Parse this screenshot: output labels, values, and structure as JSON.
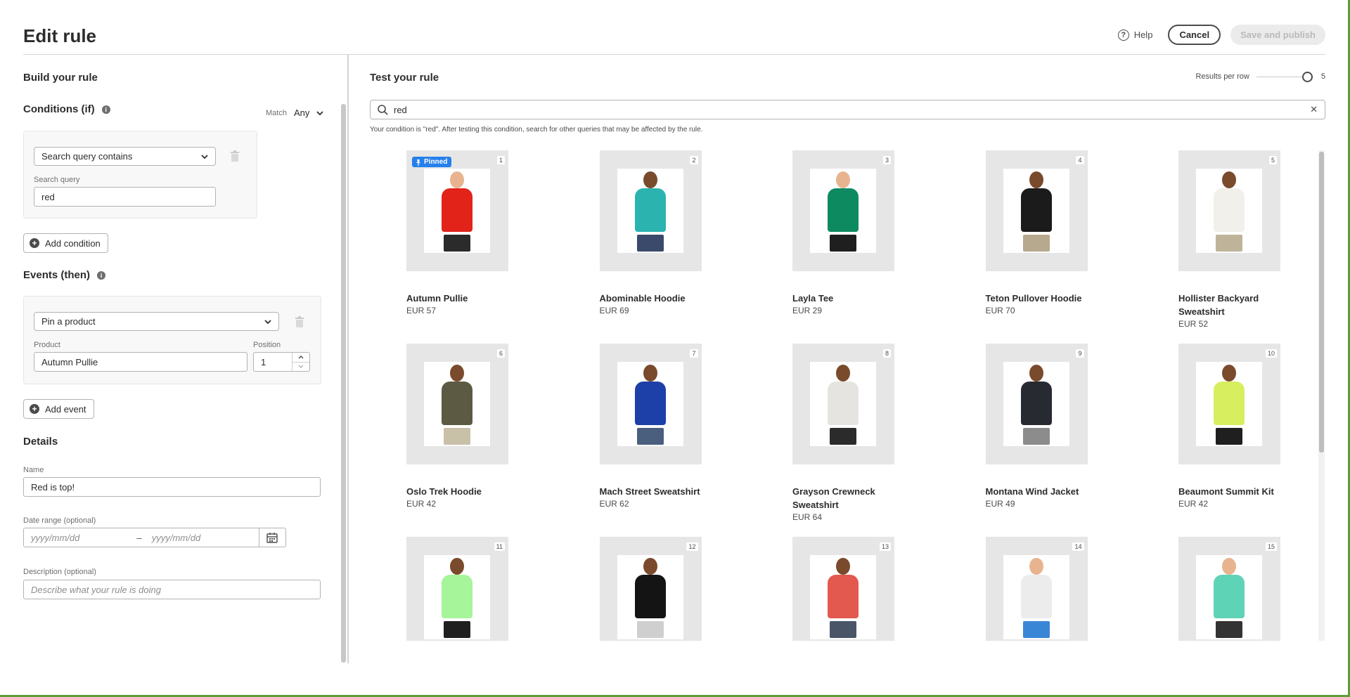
{
  "header": {
    "title": "Edit rule",
    "help_label": "Help",
    "cancel_label": "Cancel",
    "save_label": "Save and publish"
  },
  "build": {
    "heading": "Build your rule",
    "conditions_heading": "Conditions (if)",
    "match_label": "Match",
    "match_value": "Any",
    "condition_type": "Search query contains",
    "search_query_label": "Search query",
    "search_query_value": "red",
    "add_condition_label": "Add condition",
    "events_heading": "Events (then)",
    "event_type": "Pin a product",
    "product_label": "Product",
    "product_value": "Autumn Pullie",
    "position_label": "Position",
    "position_value": "1",
    "add_event_label": "Add event",
    "details_heading": "Details",
    "name_label": "Name",
    "name_value": "Red is top!",
    "date_range_label": "Date range (optional)",
    "date_start_placeholder": "yyyy/mm/dd",
    "date_separator": "–",
    "date_end_placeholder": "yyyy/mm/dd",
    "description_label": "Description (optional)",
    "description_placeholder": "Describe what your rule is doing"
  },
  "test": {
    "heading": "Test your rule",
    "results_per_row_label": "Results per row",
    "results_per_row_value": "5",
    "search_value": "red",
    "hint": "Your condition is \"red\". After testing this condition, search for other queries that may be affected by the rule.",
    "pinned_label": "Pinned"
  },
  "products": [
    {
      "index": "1",
      "name": "Autumn Pullie",
      "price": "EUR 57",
      "pinned": true,
      "skin": "#e8b48f",
      "top": "#e2231a",
      "bottom": "#2b2b2b"
    },
    {
      "index": "2",
      "name": "Abominable Hoodie",
      "price": "EUR 69",
      "skin": "#7a4a2c",
      "top": "#2bb3b0",
      "bottom": "#3b4a6b"
    },
    {
      "index": "3",
      "name": "Layla Tee",
      "price": "EUR 29",
      "skin": "#e8b48f",
      "top": "#0e8a61",
      "bottom": "#1f1f1f"
    },
    {
      "index": "4",
      "name": "Teton Pullover Hoodie",
      "price": "EUR 70",
      "skin": "#7a4a2c",
      "top": "#1b1b1b",
      "bottom": "#b7a98e"
    },
    {
      "index": "5",
      "name": "Hollister Backyard Sweatshirt",
      "price": "EUR 52",
      "skin": "#7a4a2c",
      "top": "#f2f0ea",
      "bottom": "#bfb49a"
    },
    {
      "index": "6",
      "name": "Oslo Trek Hoodie",
      "price": "EUR 42",
      "skin": "#7a4a2c",
      "top": "#5c5a43",
      "bottom": "#c9c0a8"
    },
    {
      "index": "7",
      "name": "Mach Street Sweatshirt",
      "price": "EUR 62",
      "skin": "#7a4a2c",
      "top": "#1d3fa8",
      "bottom": "#4a5f7e"
    },
    {
      "index": "8",
      "name": "Grayson Crewneck Sweatshirt",
      "price": "EUR 64",
      "skin": "#7a4a2c",
      "top": "#e5e4e0",
      "bottom": "#2b2b2b"
    },
    {
      "index": "9",
      "name": "Montana Wind Jacket",
      "price": "EUR 49",
      "skin": "#7a4a2c",
      "top": "#272a30",
      "bottom": "#8c8c8c"
    },
    {
      "index": "10",
      "name": "Beaumont Summit Kit",
      "price": "EUR 42",
      "skin": "#7a4a2c",
      "top": "#d7ef5f",
      "bottom": "#1f1f1f"
    },
    {
      "index": "11",
      "name": "",
      "price": "",
      "skin": "#7a4a2c",
      "top": "#a7f59a",
      "bottom": "#1f1f1f"
    },
    {
      "index": "12",
      "name": "",
      "price": "",
      "skin": "#7a4a2c",
      "top": "#141414",
      "bottom": "#cfcfcf"
    },
    {
      "index": "13",
      "name": "",
      "price": "",
      "skin": "#7a4a2c",
      "top": "#e3584f",
      "bottom": "#4a5568"
    },
    {
      "index": "14",
      "name": "",
      "price": "",
      "skin": "#e8b48f",
      "top": "#ececec",
      "bottom": "#3a86d6"
    },
    {
      "index": "15",
      "name": "",
      "price": "",
      "skin": "#e8b48f",
      "top": "#5fd3b5",
      "bottom": "#333333"
    }
  ],
  "colors": {
    "accent_blue": "#2680eb",
    "frame_green": "#5f9c3a"
  }
}
